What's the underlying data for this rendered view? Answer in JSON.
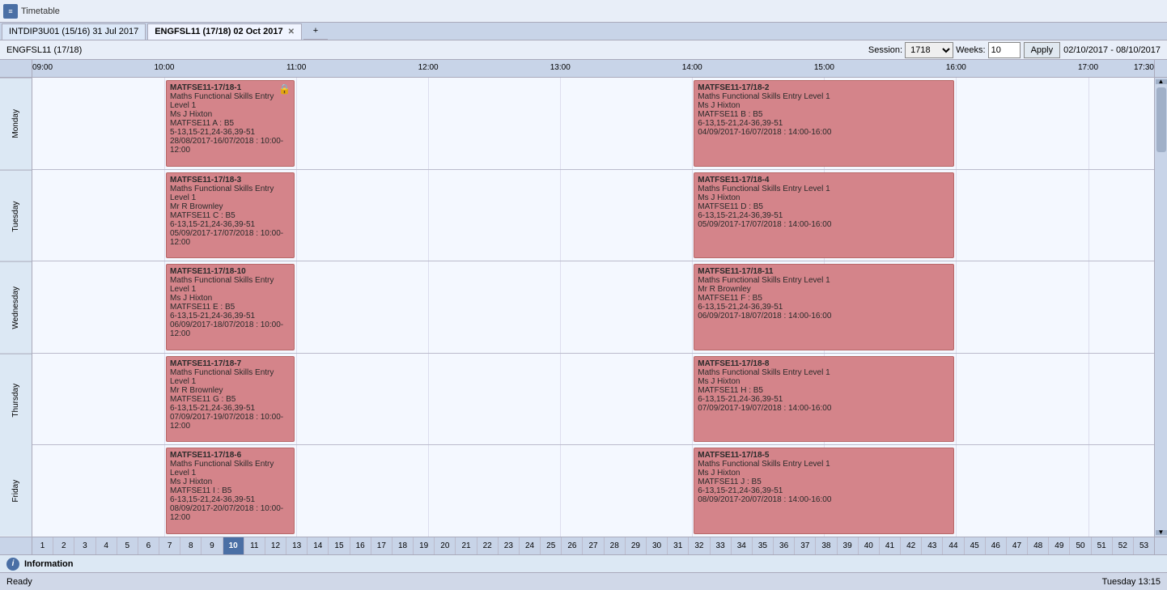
{
  "titlebar": {
    "icon": "≡",
    "appName": "Timetable"
  },
  "tabs": [
    {
      "id": "tab1",
      "label": "INTDIP3U01 (15/16) 31 Jul 2017",
      "active": false,
      "closable": false
    },
    {
      "id": "tab2",
      "label": "ENGFSL11 (17/18) 02 Oct 2017",
      "active": true,
      "closable": true
    }
  ],
  "secondTab": {
    "label": "ENGFSL11 (17/18)"
  },
  "toolbar": {
    "sessionLabel": "Session:",
    "sessionValue": "1718",
    "sessionOptions": [
      "1718"
    ],
    "weeksLabel": "Weeks:",
    "weeksValue": "10",
    "applyLabel": "Apply",
    "dateRange": "02/10/2017 - 08/10/2017"
  },
  "timeLabels": [
    "09:00",
    "10:00",
    "11:00",
    "12:00",
    "13:00",
    "14:00",
    "15:00",
    "16:00",
    "17:00",
    "17:30"
  ],
  "days": [
    "Monday",
    "Tuesday",
    "Wednesday",
    "Thursday",
    "Friday"
  ],
  "weekNumbers": [
    "1",
    "2",
    "3",
    "4",
    "5",
    "6",
    "7",
    "8",
    "9",
    "10",
    "11",
    "12",
    "13",
    "14",
    "15",
    "16",
    "17",
    "18",
    "19",
    "20",
    "21",
    "22",
    "23",
    "24",
    "25",
    "26",
    "27",
    "28",
    "29",
    "30",
    "31",
    "32",
    "33",
    "34",
    "35",
    "36",
    "37",
    "38",
    "39",
    "40",
    "41",
    "42",
    "43",
    "44",
    "45",
    "46",
    "47",
    "48",
    "49",
    "50",
    "51",
    "52",
    "53"
  ],
  "activeWeek": "10",
  "events": [
    {
      "id": "e1",
      "day": 0,
      "startHour": 10.0,
      "endHour": 12.0,
      "code": "MATFSE11-17/18-1",
      "title": "Maths Functional Skills Entry Level 1",
      "teacher": "Ms J Hixton",
      "room": "MATFSE11 A : B5",
      "weeks": "5-13,15-21,24-36,39-51",
      "dates": "28/08/2017-16/07/2018 : 10:00-12:00",
      "locked": true
    },
    {
      "id": "e2",
      "day": 0,
      "startHour": 14.0,
      "endHour": 16.0,
      "code": "MATFSE11-17/18-2",
      "title": "Maths Functional Skills Entry Level 1",
      "teacher": "Ms J Hixton",
      "room": "MATFSE11 B : B5",
      "weeks": "6-13,15-21,24-36,39-51",
      "dates": "04/09/2017-16/07/2018 : 14:00-16:00",
      "locked": false
    },
    {
      "id": "e3",
      "day": 1,
      "startHour": 10.0,
      "endHour": 12.0,
      "code": "MATFSE11-17/18-3",
      "title": "Maths Functional Skills Entry Level 1",
      "teacher": "Mr R Brownley",
      "room": "MATFSE11 C : B5",
      "weeks": "6-13,15-21,24-36,39-51",
      "dates": "05/09/2017-17/07/2018 : 10:00-12:00",
      "locked": false
    },
    {
      "id": "e4",
      "day": 1,
      "startHour": 14.0,
      "endHour": 16.0,
      "code": "MATFSE11-17/18-4",
      "title": "Maths Functional Skills Entry Level 1",
      "teacher": "Ms J Hixton",
      "room": "MATFSE11 D : B5",
      "weeks": "6-13,15-21,24-36,39-51",
      "dates": "05/09/2017-17/07/2018 : 14:00-16:00",
      "locked": false
    },
    {
      "id": "e5",
      "day": 2,
      "startHour": 10.0,
      "endHour": 12.0,
      "code": "MATFSE11-17/18-10",
      "title": "Maths Functional Skills Entry Level 1",
      "teacher": "Ms J Hixton",
      "room": "MATFSE11 E : B5",
      "weeks": "6-13,15-21,24-36,39-51",
      "dates": "06/09/2017-18/07/2018 : 10:00-12:00",
      "locked": false
    },
    {
      "id": "e6",
      "day": 2,
      "startHour": 14.0,
      "endHour": 16.0,
      "code": "MATFSE11-17/18-11",
      "title": "Maths Functional Skills Entry Level 1",
      "teacher": "Mr R Brownley",
      "room": "MATFSE11 F : B5",
      "weeks": "6-13,15-21,24-36,39-51",
      "dates": "06/09/2017-18/07/2018 : 14:00-16:00",
      "locked": false
    },
    {
      "id": "e7",
      "day": 3,
      "startHour": 10.0,
      "endHour": 12.0,
      "code": "MATFSE11-17/18-7",
      "title": "Maths Functional Skills Entry Level 1",
      "teacher": "Mr R Brownley",
      "room": "MATFSE11 G : B5",
      "weeks": "6-13,15-21,24-36,39-51",
      "dates": "07/09/2017-19/07/2018 : 10:00-12:00",
      "locked": false
    },
    {
      "id": "e8",
      "day": 3,
      "startHour": 14.0,
      "endHour": 16.0,
      "code": "MATFSE11-17/18-8",
      "title": "Maths Functional Skills Entry Level 1",
      "teacher": "Ms J Hixton",
      "room": "MATFSE11 H : B5",
      "weeks": "6-13,15-21,24-36,39-51",
      "dates": "07/09/2017-19/07/2018 : 14:00-16:00",
      "locked": false
    },
    {
      "id": "e9",
      "day": 4,
      "startHour": 10.0,
      "endHour": 12.0,
      "code": "MATFSE11-17/18-6",
      "title": "Maths Functional Skills Entry Level 1",
      "teacher": "Ms J Hixton",
      "room": "MATFSE11 I : B5",
      "weeks": "6-13,15-21,24-36,39-51",
      "dates": "08/09/2017-20/07/2018 : 10:00-12:00",
      "locked": false
    },
    {
      "id": "e10",
      "day": 4,
      "startHour": 14.0,
      "endHour": 16.0,
      "code": "MATFSE11-17/18-5",
      "title": "Maths Functional Skills Entry Level 1",
      "teacher": "Ms J Hixton",
      "room": "MATFSE11 J : B5",
      "weeks": "6-13,15-21,24-36,39-51",
      "dates": "08/09/2017-20/07/2018 : 14:00-16:00",
      "locked": false
    }
  ],
  "infoBar": {
    "label": "Information"
  },
  "statusBar": {
    "left": "Ready",
    "right": "Tuesday 13:15"
  },
  "colors": {
    "eventBg": "#d4848a",
    "eventBorder": "#b86868",
    "headerBg": "#c8d4e8",
    "gridBg": "#f4f8ff",
    "activeDayBg": "#dce8f4"
  }
}
